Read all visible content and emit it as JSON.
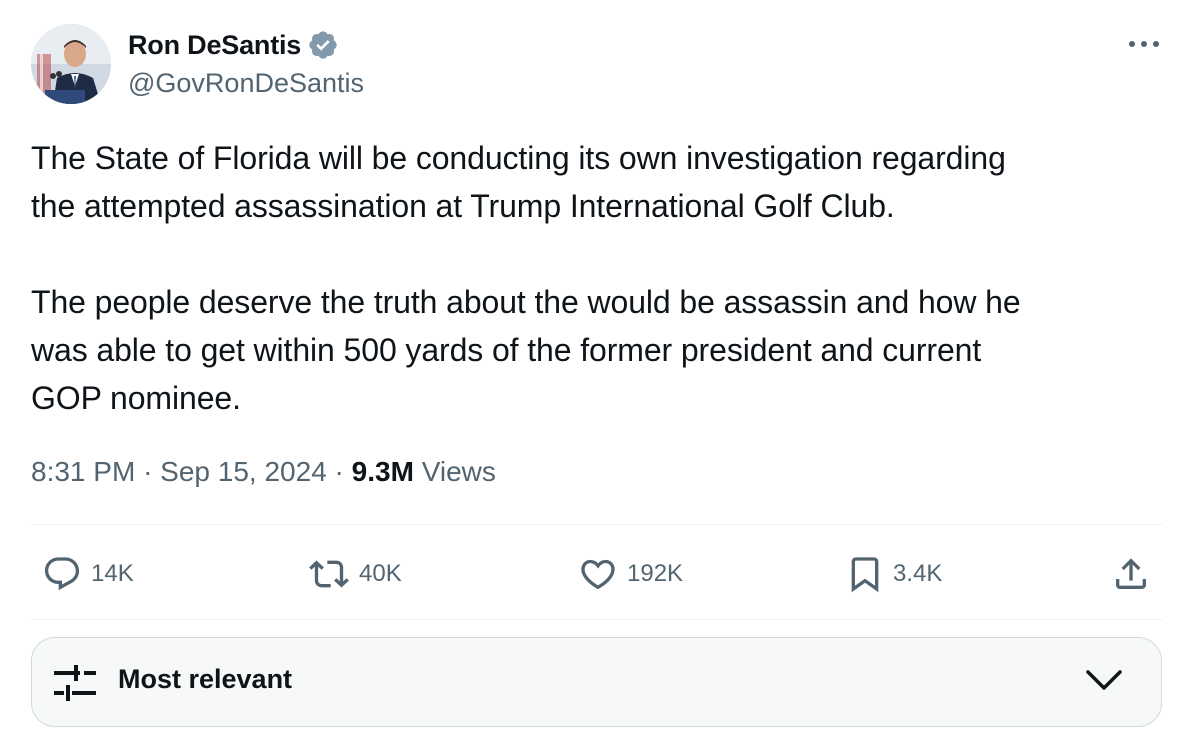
{
  "author": {
    "display_name": "Ron DeSantis",
    "handle": "@GovRonDeSantis",
    "verified": true,
    "verified_icon": "verified-badge-icon",
    "verified_color": "#829aab"
  },
  "tweet": {
    "paragraph_1_line_1": "The State of Florida will be conducting its own investigation regarding",
    "paragraph_1_line_2": "the attempted assassination at Trump International Golf Club.",
    "paragraph_2_line_1": "The people deserve the truth about the would be assassin and how he",
    "paragraph_2_line_2": "was able to get within 500 yards of the former president and current",
    "paragraph_2_line_3": "GOP nominee."
  },
  "meta": {
    "time": "8:31 PM",
    "separator": "·",
    "date": "Sep 15, 2024",
    "views_count": "9.3M",
    "views_label": "Views"
  },
  "actions": {
    "reply": {
      "icon": "reply-icon",
      "count": "14K"
    },
    "repost": {
      "icon": "repost-icon",
      "count": "40K"
    },
    "like": {
      "icon": "heart-icon",
      "count": "192K"
    },
    "bookmark": {
      "icon": "bookmark-icon",
      "count": "3.4K"
    },
    "share": {
      "icon": "share-icon"
    }
  },
  "sort": {
    "label": "Most relevant",
    "icon": "sort-sliders-icon",
    "dropdown_icon": "chevron-down-icon"
  },
  "colors": {
    "text_primary": "#0f1419",
    "text_secondary": "#536471",
    "divider": "#eff3f4",
    "sort_box_bg": "#f7f9f9"
  }
}
